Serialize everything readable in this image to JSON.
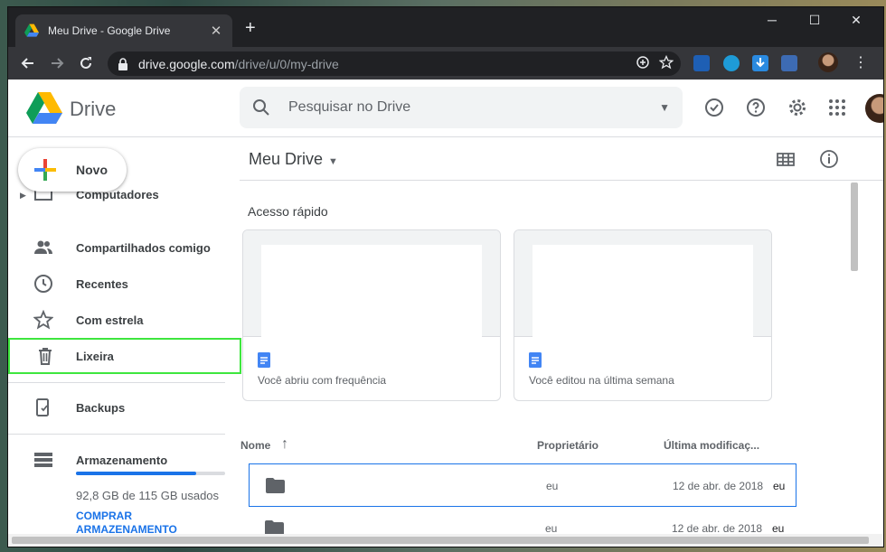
{
  "browser": {
    "tab_title": "Meu Drive - Google Drive",
    "tab_close": "✕",
    "new_tab": "+",
    "url_host": "drive.google.com",
    "url_path": "/drive/u/0/my-drive",
    "win_min": "─",
    "win_max": "☐",
    "win_close": "✕"
  },
  "header": {
    "app_name": "Drive",
    "search_placeholder": "Pesquisar no Drive"
  },
  "sidebar": {
    "new_label": "Novo",
    "items": [
      {
        "label": "Computadores"
      },
      {
        "label": "Compartilhados comigo"
      },
      {
        "label": "Recentes"
      },
      {
        "label": "Com estrela"
      },
      {
        "label": "Lixeira"
      },
      {
        "label": "Backups"
      },
      {
        "label": "Armazenamento"
      }
    ],
    "storage_used_fraction": 0.807,
    "storage_text": "92,8 GB de 115 GB usados",
    "buy_storage": "COMPRAR ARMAZENAMENTO"
  },
  "main": {
    "title": "Meu Drive",
    "caret": "▼",
    "quick_access_label": "Acesso rápido",
    "quick_cards": [
      {
        "caption": "Você abriu com frequência"
      },
      {
        "caption": "Você editou na última semana"
      }
    ],
    "columns": {
      "name": "Nome",
      "sort_arrow": "↑",
      "owner": "Proprietário",
      "modified": "Última modificaç..."
    },
    "rows": [
      {
        "owner": "eu",
        "modified": "12 de abr. de 2018",
        "modified_by": "eu"
      },
      {
        "owner": "eu",
        "modified": "12 de abr. de 2018",
        "modified_by": "eu"
      }
    ]
  },
  "colors": {
    "accent": "#1a73e8",
    "highlight_box": "#3ee63e",
    "chrome_dark": "#202124"
  }
}
